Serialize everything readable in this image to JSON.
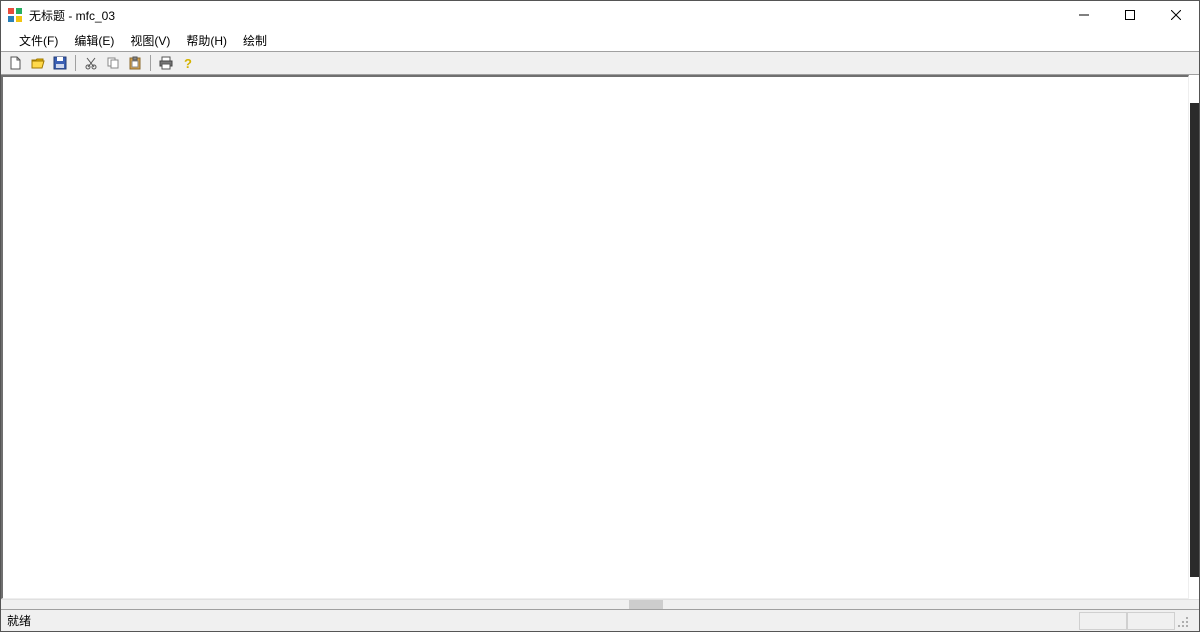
{
  "titlebar": {
    "title": "无标题 - mfc_03"
  },
  "menus": [
    "文件(F)",
    "编辑(E)",
    "视图(V)",
    "帮助(H)",
    "绘制"
  ],
  "toolbar": {
    "new": "new-file-icon",
    "open": "open-folder-icon",
    "save": "save-icon",
    "cut": "cut-icon",
    "copy": "copy-icon",
    "paste": "paste-icon",
    "print": "print-icon",
    "help": "help-icon"
  },
  "status": {
    "text": "就绪"
  }
}
